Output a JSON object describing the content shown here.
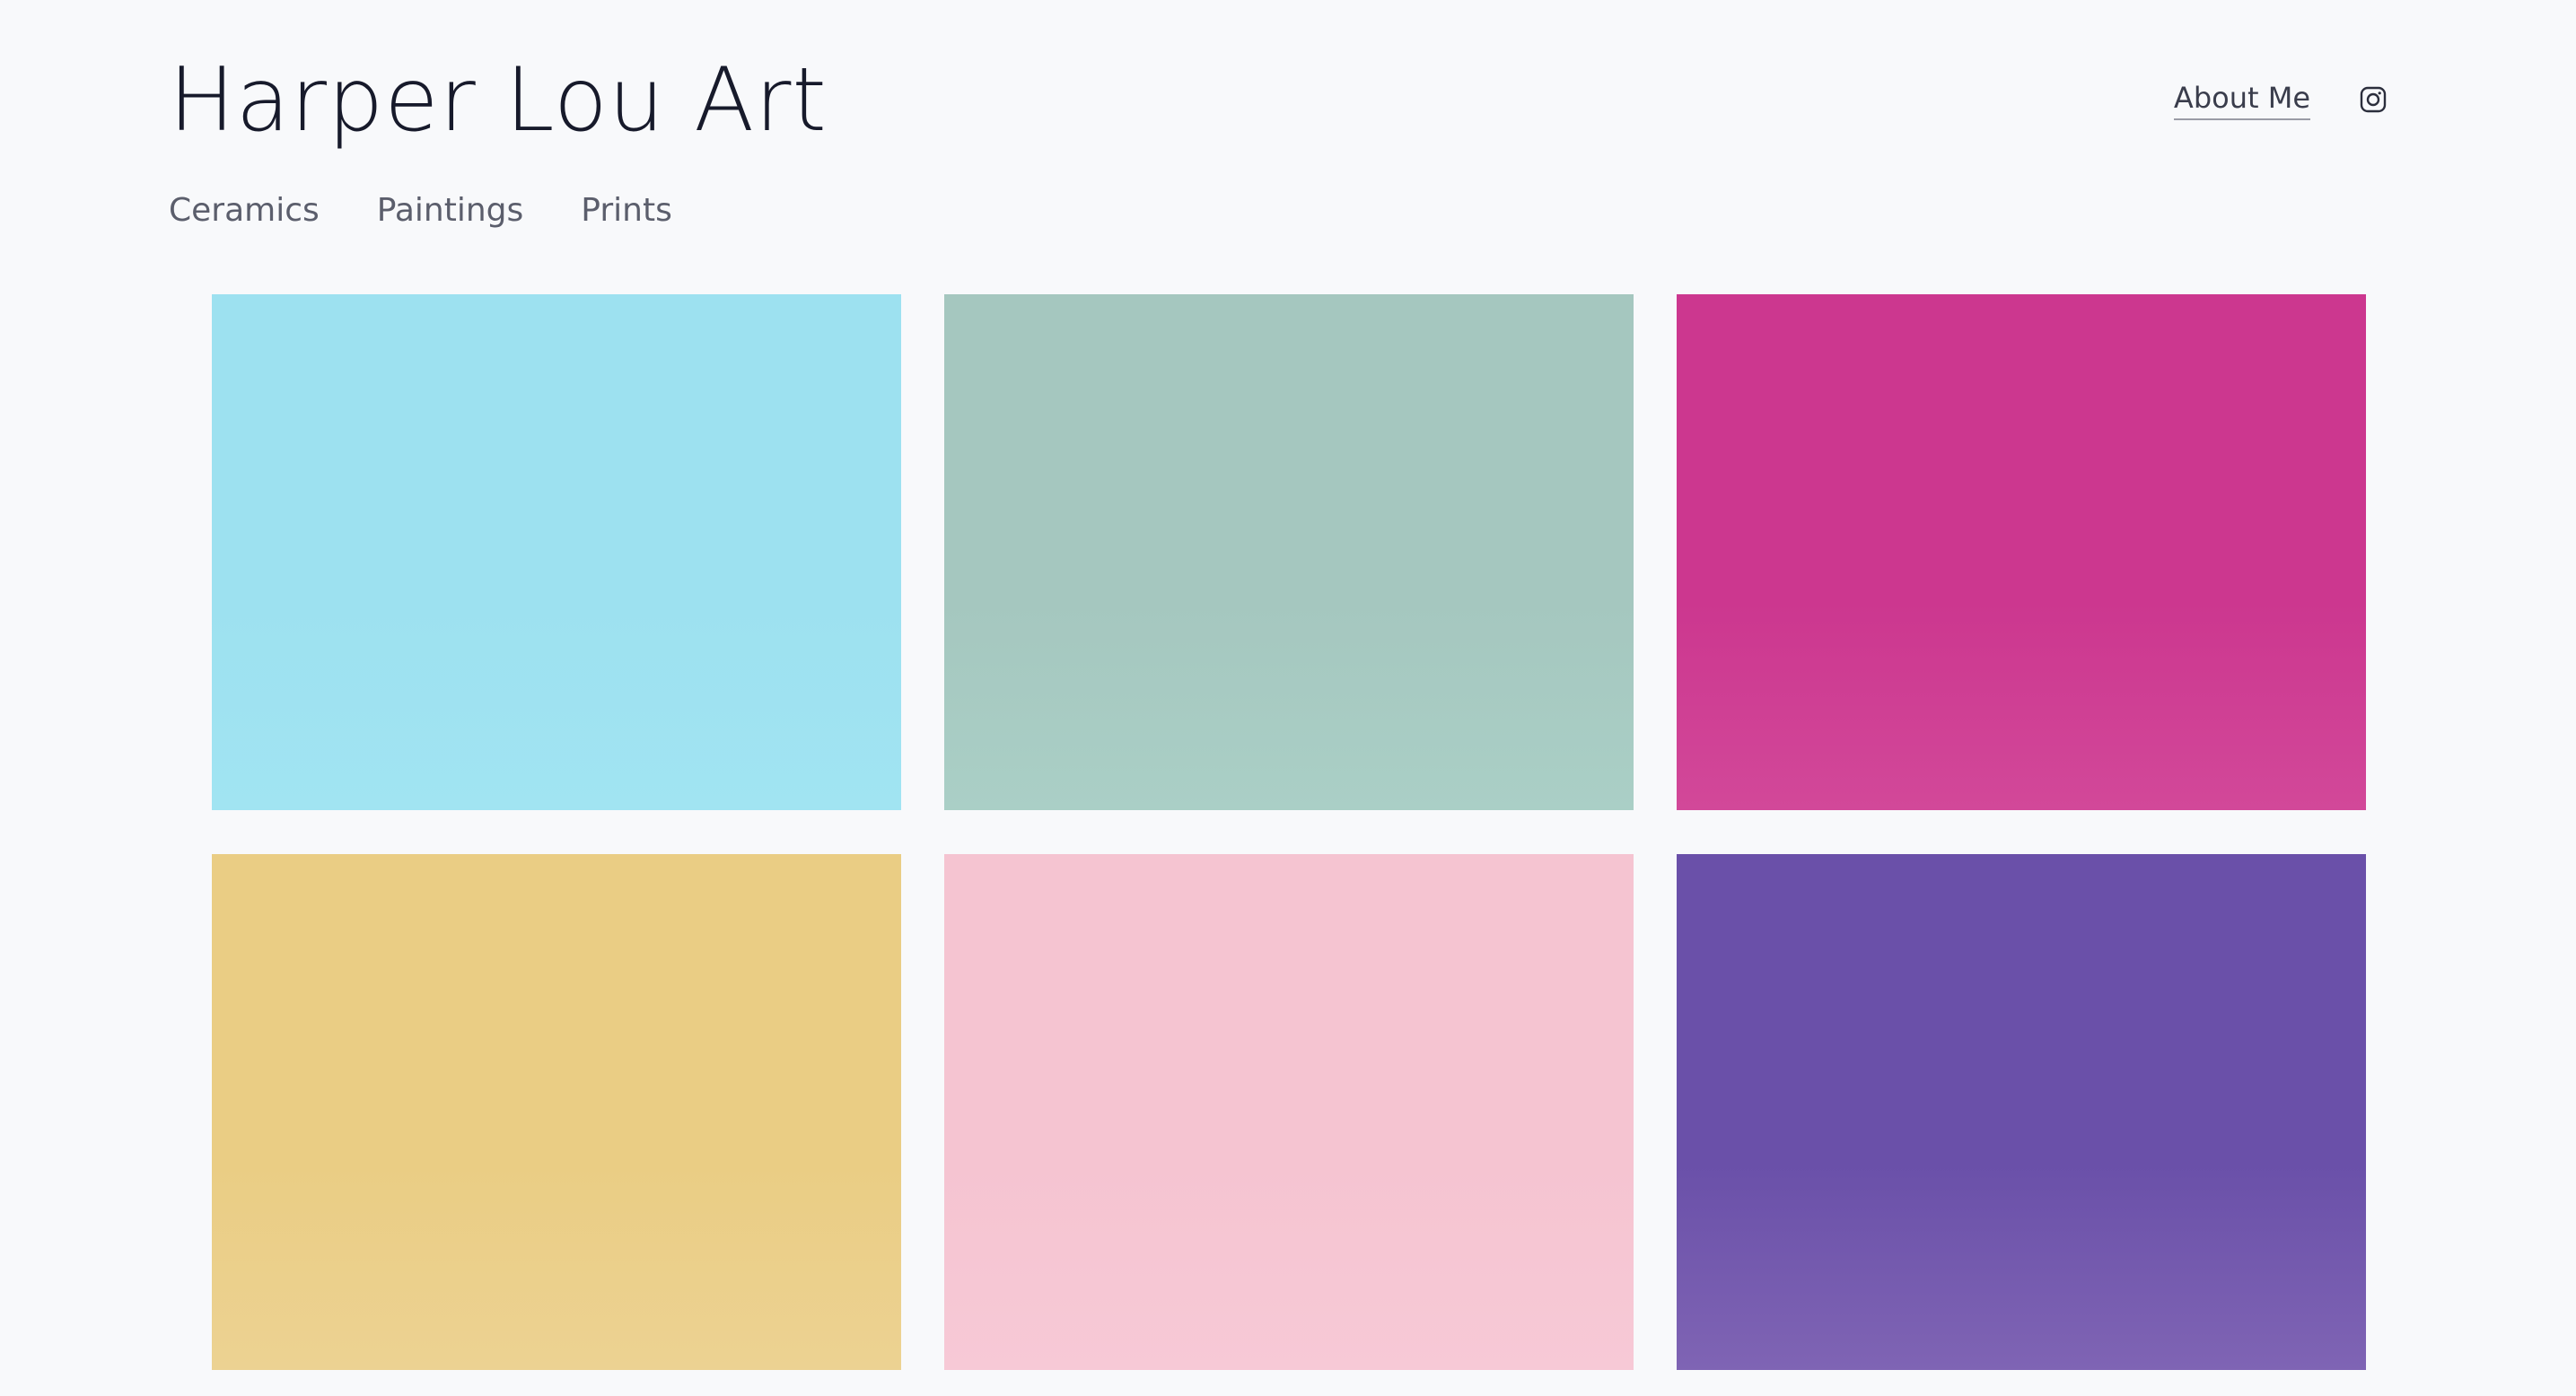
{
  "header": {
    "site_title": "Harper Lou Art",
    "about_label": "About Me",
    "social_icon": "instagram-icon"
  },
  "nav": {
    "items": [
      {
        "label": "Ceramics"
      },
      {
        "label": "Paintings"
      },
      {
        "label": "Prints"
      }
    ]
  },
  "gallery": {
    "tiles": [
      {
        "color": "#9de1f0",
        "color_bottom": "#a1e4f2"
      },
      {
        "color": "#a5c7bf",
        "color_bottom": "#aacfc6"
      },
      {
        "color": "#cc378f",
        "color_bottom": "#d24899"
      },
      {
        "color": "#eacd84",
        "color_bottom": "#ecd292"
      },
      {
        "color": "#f5c4d1",
        "color_bottom": "#f7c9d6"
      },
      {
        "color": "#6a50a9",
        "color_bottom": "#7f64b4"
      }
    ]
  },
  "colors": {
    "background": "#f8f9fb",
    "title_text": "#171a2b",
    "nav_text": "#5b5e6c"
  }
}
